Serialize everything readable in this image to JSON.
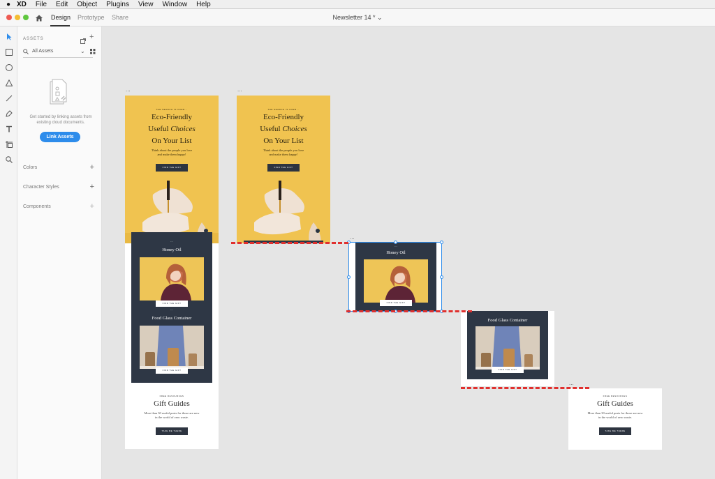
{
  "menubar": {
    "app": "XD",
    "items": [
      "File",
      "Edit",
      "Object",
      "Plugins",
      "View",
      "Window",
      "Help"
    ]
  },
  "titlebar": {
    "tabs": [
      "Design",
      "Prototype",
      "Share"
    ],
    "document_title": "Newsletter 14 * ⌄"
  },
  "panel": {
    "title": "ASSETS",
    "filter": "All Assets",
    "empty_text": "Get started by linking assets from existing cloud documents.",
    "link_button": "Link Assets",
    "sections": [
      "Colors",
      "Character Styles",
      "Components"
    ]
  },
  "artboards": {
    "dots": "...",
    "hero": {
      "kicker": "THE SEARCH IS OVER...",
      "line1": "Eco-Friendly",
      "line2_a": "Useful ",
      "line2_b": "Choices",
      "line3": "On Your List",
      "sub1": "Think about the people you love",
      "sub2": "and make them happy!",
      "button": "FIND THE GIFT"
    },
    "card1": {
      "title": "Honey Oil",
      "button": "FIND THE GIFT"
    },
    "card2": {
      "title": "Food Glass Container",
      "button": "FIND THE GIFT"
    },
    "gift": {
      "kicker": "FREE RESOURCES",
      "title": "Gift Guides",
      "text1": "More than 30 useful posts for those are new",
      "text2": "in the world of zero waste.",
      "button": "TAKE ME THERE"
    }
  },
  "colors": {
    "accent": "#2d8ceb",
    "hero_yellow": "#f0c350",
    "card_navy": "#2e3745",
    "guide_red": "#e0302e"
  }
}
